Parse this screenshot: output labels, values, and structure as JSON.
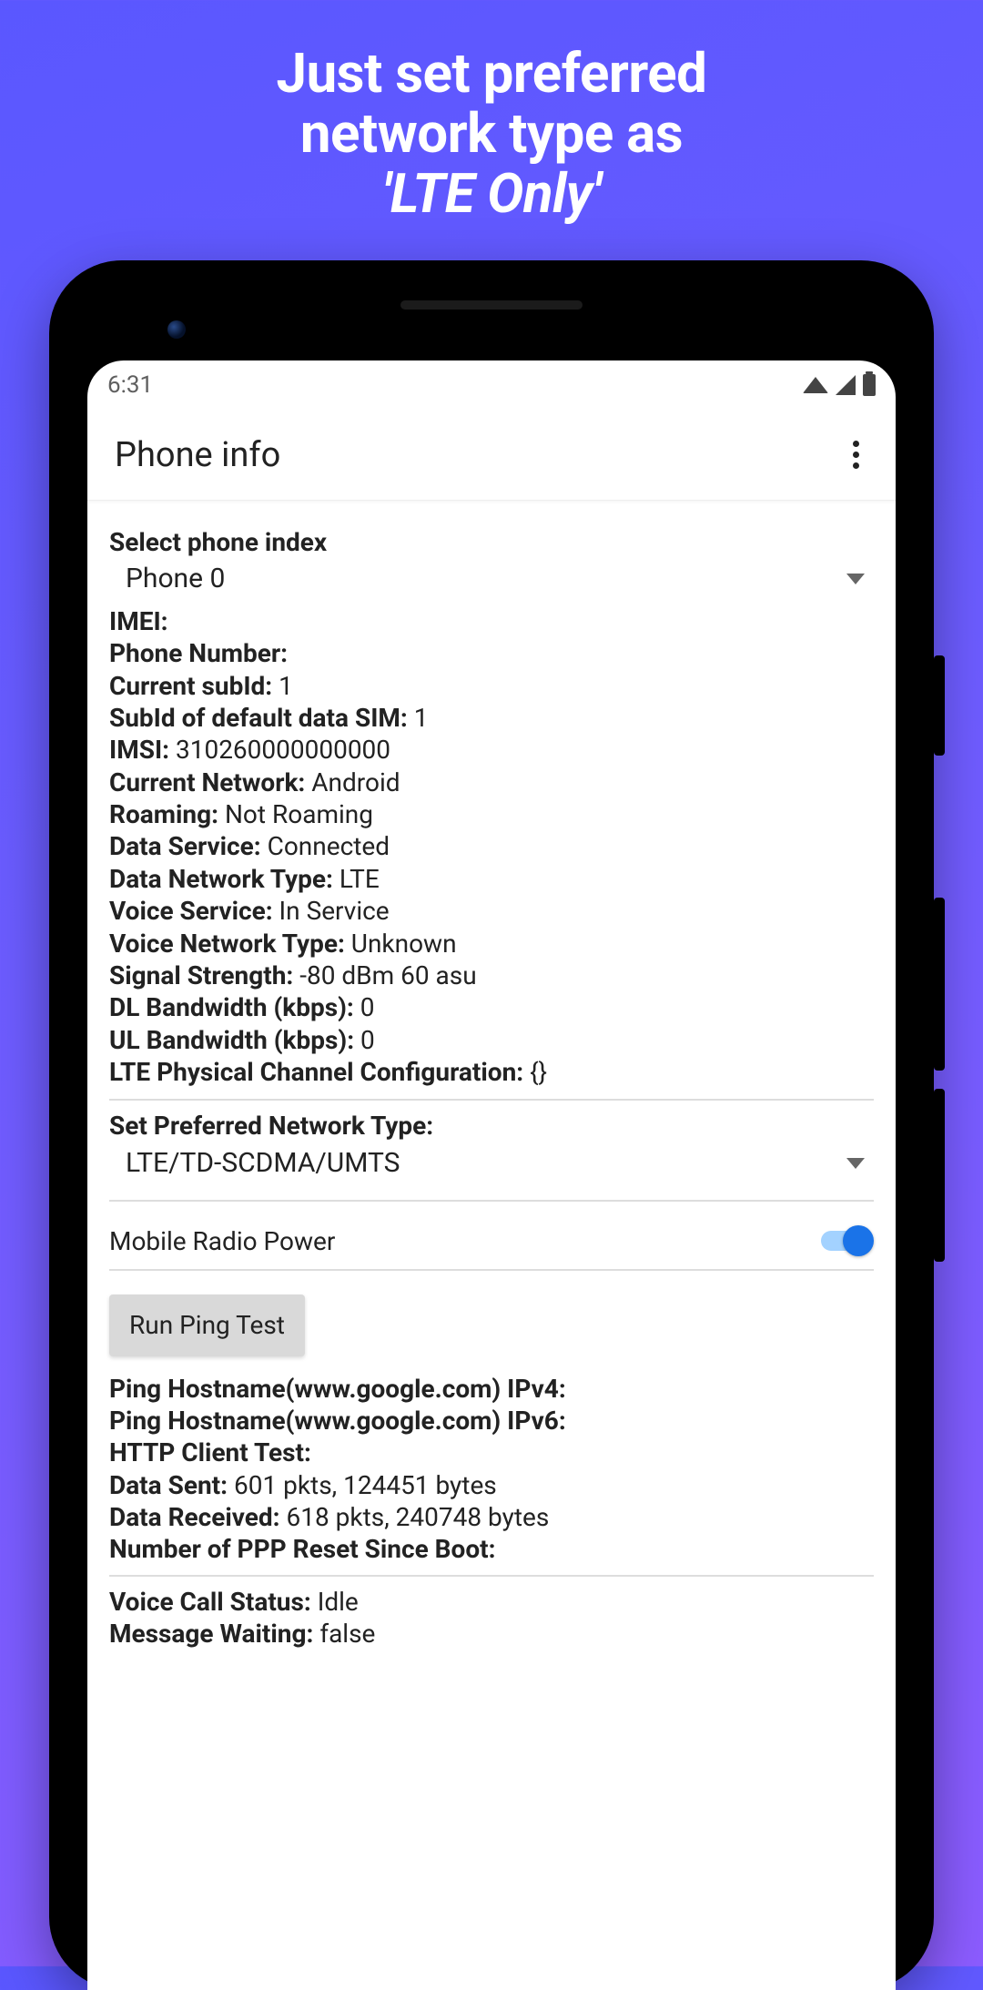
{
  "promo": {
    "line1": "Just set preferred",
    "line2": "network type as",
    "line3": "'LTE Only'"
  },
  "statusbar": {
    "time": "6:31"
  },
  "appbar": {
    "title": "Phone info"
  },
  "phone_index": {
    "label": "Select phone index",
    "selected": "Phone 0"
  },
  "info": {
    "imei_label": "IMEI:",
    "imei_value": "",
    "phone_number_label": "Phone Number:",
    "phone_number_value": "",
    "current_subid_label": "Current subId:",
    "current_subid_value": "1",
    "subid_default_label": "SubId of default data SIM:",
    "subid_default_value": "1",
    "imsi_label": "IMSI:",
    "imsi_value": "310260000000000",
    "current_network_label": "Current Network:",
    "current_network_value": "Android",
    "roaming_label": "Roaming:",
    "roaming_value": "Not Roaming",
    "data_service_label": "Data Service:",
    "data_service_value": "Connected",
    "data_net_type_label": "Data Network Type:",
    "data_net_type_value": "LTE",
    "voice_service_label": "Voice Service:",
    "voice_service_value": "In Service",
    "voice_net_type_label": "Voice Network Type:",
    "voice_net_type_value": "Unknown",
    "signal_label": "Signal Strength:",
    "signal_value": "-80 dBm   60 asu",
    "dl_bw_label": "DL Bandwidth (kbps):",
    "dl_bw_value": "0",
    "ul_bw_label": "UL Bandwidth (kbps):",
    "ul_bw_value": "0",
    "lte_pcc_label": "LTE Physical Channel Configuration:",
    "lte_pcc_value": "{}"
  },
  "pref_net": {
    "label": "Set Preferred Network Type:",
    "selected": "LTE/TD-SCDMA/UMTS"
  },
  "radio_power": {
    "label": "Mobile Radio Power",
    "on": true
  },
  "ping": {
    "button": "Run Ping Test",
    "host_v4_label": "Ping Hostname(www.google.com) IPv4:",
    "host_v6_label": "Ping Hostname(www.google.com) IPv6:",
    "http_label": "HTTP Client Test:",
    "data_sent_label": "Data Sent:",
    "data_sent_value": "601 pkts, 124451 bytes",
    "data_recv_label": "Data Received:",
    "data_recv_value": "618 pkts, 240748 bytes",
    "ppp_reset_label": "Number of PPP Reset Since Boot:"
  },
  "call": {
    "voice_status_label": "Voice Call Status:",
    "voice_status_value": "Idle",
    "msg_wait_label": "Message Waiting:",
    "msg_wait_value": "false"
  }
}
